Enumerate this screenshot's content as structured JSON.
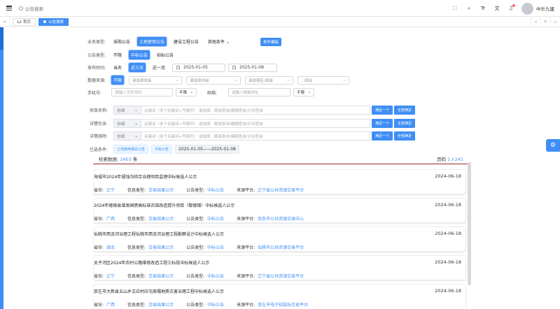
{
  "topbar": {
    "breadcrumb": "公告搜索",
    "user_name": "中乐九建",
    "icons": [
      "fullscreen-icon",
      "search-icon",
      "font-size-icon",
      "translate-icon",
      "bell-icon"
    ]
  },
  "tabs": [
    {
      "label": "首页",
      "active": false
    },
    {
      "label": "公告搜索",
      "active": true
    }
  ],
  "filters": {
    "business_type": {
      "label": "业务类型:",
      "options": [
        "采购公告",
        "土地使用公告",
        "建设工程公告",
        "其他条件"
      ],
      "selected": "土地使用公告",
      "template_button": "条件模板"
    },
    "notice_type": {
      "label": "公告类型:",
      "options": [
        "不限",
        "中标公告",
        "招标公告"
      ],
      "selected": "中标公告"
    },
    "publish_time": {
      "label": "发布时间:",
      "options": [
        "当天",
        "近三天",
        "近一月"
      ],
      "selected": "近三天",
      "start": "2025-01-05",
      "end": "2025-01-08"
    },
    "data_source": {
      "label": "数据来源:",
      "options": [
        "不限"
      ],
      "selected": "不限",
      "province": "请选择省级",
      "city": "请选择市级",
      "district": "请选择区/县级",
      "site": "...网站"
    },
    "phone": {
      "label": "手机号:",
      "placeholder": "请输入手机号码",
      "mode": "不限"
    },
    "email": {
      "label": "邮箱:",
      "placeholder": "请输入邮箱地址",
      "mode": "不限"
    }
  },
  "keywords": [
    {
      "label": "项目名称:",
      "mode": "分词",
      "placeholder": "关键词（多个关键词+号隔开） 请选择：精准查询/模糊查询/分词查询",
      "btn_one": "满足一个",
      "btn_all": "全部满足"
    },
    {
      "label": "详情包含:",
      "mode": "分词",
      "placeholder": "关键词（多个关键词+号隔开） 请选择：精准查询/模糊查询/分词查询",
      "btn_one": "满足一个",
      "btn_all": "全部满足"
    },
    {
      "label": "详情排除:",
      "mode": "分词",
      "placeholder": "关键词（多个关键词+号隔开） 请选择：精准查询/模糊查询/分词查询",
      "btn_one": "满足一个",
      "btn_all": "全部满足"
    }
  ],
  "selected_conditions": {
    "label": "已选条件:",
    "chips": [
      "土地使用相关公告",
      "中标公告"
    ],
    "date_range": "2025-01-05——2025-01-08"
  },
  "results": {
    "count_label": "检索数据:",
    "count": "2403",
    "count_unit": "条",
    "page_label": "页码",
    "page_current": "1",
    "page_total": "241",
    "field_labels": {
      "province": "省份:",
      "info_type": "信息类型:",
      "notice_type": "公告类型:",
      "source": "来源平台:"
    },
    "items": [
      {
        "title": "海城市2024年侵蚀沟综合治理项目监理中标候选人公示",
        "date": "2024-06-18",
        "province": "辽宁",
        "info_type": "交易结果公示",
        "notice_type": "中标公告",
        "source": "辽宁省公共资源交易平台"
      },
      {
        "title": "2024年德保县增发国债高标准农田改造提升项目（敬德镇）中标候选人公示",
        "date": "2024-06-18",
        "province": "广西",
        "info_type": "交易结果公示",
        "notice_type": "中标公告",
        "source": "百色市公共资源交易中心"
      },
      {
        "title": "仙桃市西流河治理工程仙桃市西流河治理工程勘察设计中标候选人公示",
        "date": "2024-06-18",
        "province": "湖北",
        "info_type": "交易结果公示",
        "notice_type": "中标公告",
        "source": "仙桃市公共资源交易平台"
      },
      {
        "title": "太子河区2024年农村公路维修改造工程三标段中标候选人公示",
        "date": "2024-06-18",
        "province": "辽宁",
        "info_type": "交易结果公示",
        "notice_type": "中标公告",
        "source": "辽宁省公共资源交易平台"
      },
      {
        "title": "崇左市大新县五山乡文应村应屯崩塌地质灾害治理工程中标候选人公示",
        "date": "2024-06-18",
        "province": "广西",
        "info_type": "交易结果公示",
        "notice_type": "中标公告",
        "source": "崇左市电子招投标交易平台"
      }
    ]
  },
  "colors": {
    "accent": "#3f8ef5",
    "divider": "#9b2c2c"
  }
}
